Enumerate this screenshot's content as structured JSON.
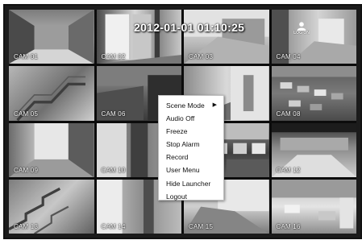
{
  "timestamp": "2012-01-01 01:10:25",
  "logon_label": "LOG ON",
  "cameras": [
    {
      "label": "CAM 01"
    },
    {
      "label": "CAM 02"
    },
    {
      "label": "CAM 03"
    },
    {
      "label": "CAM 04"
    },
    {
      "label": "CAM 05"
    },
    {
      "label": "CAM 06"
    },
    {
      "label": "CAM 07"
    },
    {
      "label": "CAM 08"
    },
    {
      "label": "CAM 09"
    },
    {
      "label": "CAM 10"
    },
    {
      "label": "CAM 11"
    },
    {
      "label": "CAM 12"
    },
    {
      "label": "CAM 13"
    },
    {
      "label": "CAM 14"
    },
    {
      "label": "CAM 15"
    },
    {
      "label": "CAM 16"
    }
  ],
  "context_menu": {
    "items": [
      {
        "label": "Scene Mode",
        "submenu_arrow": "▶"
      },
      {
        "label": "Audio Off"
      },
      {
        "label": "Freeze"
      },
      {
        "label": "Stop Alarm"
      },
      {
        "label": "Record"
      },
      {
        "label": "User Menu"
      },
      {
        "label": "Hide Launcher"
      },
      {
        "label": "Logout"
      }
    ]
  }
}
